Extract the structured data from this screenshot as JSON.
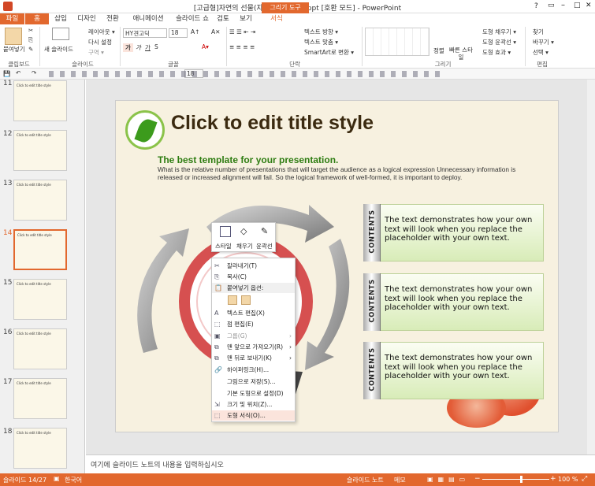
{
  "window": {
    "title": "[고급형]자연의 선물(자동완성형포함).ppt [호환 모드] - PowerPoint",
    "context_tab": "그리기 도구"
  },
  "tabs": [
    "파일",
    "홈",
    "삽입",
    "디자인",
    "전환",
    "애니메이션",
    "슬라이드 쇼",
    "검토",
    "보기",
    "서식"
  ],
  "ribbon": {
    "clipboard": {
      "paste": "붙여넣기",
      "label": "클립보드"
    },
    "slides": {
      "new_slide": "새 슬라이드",
      "layout": "레이아웃 ▾",
      "reset": "다시 설정",
      "section": "구역 ▾",
      "label": "슬라이드"
    },
    "font": {
      "name": "HY견고딕",
      "size": "18",
      "label": "글꼴"
    },
    "paragraph": {
      "text_direction": "텍스트 방향 ▾",
      "align_text": "텍스트 맞춤 ▾",
      "smartart": "SmartArt로 변환 ▾",
      "label": "단락"
    },
    "drawing": {
      "arrange": "정렬",
      "quick_styles": "빠른 스타일",
      "shape_fill": "도형 채우기 ▾",
      "shape_outline": "도형 윤곽선 ▾",
      "shape_effects": "도형 효과 ▾",
      "label": "그리기"
    },
    "editing": {
      "find": "찾기",
      "replace": "바꾸기 ▾",
      "select": "선택 ▾",
      "label": "편집"
    }
  },
  "qat": {
    "font_size": "18"
  },
  "thumbnails": [
    {
      "num": "11",
      "title": "Click to edit title style"
    },
    {
      "num": "12",
      "title": "Click to edit title style"
    },
    {
      "num": "13",
      "title": "Click to edit title style"
    },
    {
      "num": "14",
      "title": "Click to edit title style"
    },
    {
      "num": "15",
      "title": "Click to edit title style"
    },
    {
      "num": "16",
      "title": "Click to edit title style"
    },
    {
      "num": "17",
      "title": "Click to edit title style"
    },
    {
      "num": "18",
      "title": "Click to edit title style"
    }
  ],
  "slide": {
    "title": "Click to edit title style",
    "subtitle": "The best template for your presentation.",
    "body": "What is the relative number of presentations that will target the audience as a logical expression Unnecessary information is released or increased alignment will fail. So the logical framework of well-formed, it is important to deploy.",
    "boxes": [
      {
        "tag": "CONTENTS",
        "text": "The text demonstrates how your own text will look when you replace the placeholder with your own text."
      },
      {
        "tag": "CONTENTS",
        "text": "The text demonstrates how your own text will look when you replace the placeholder with your own text."
      },
      {
        "tag": "CONTENTS",
        "text": "The text demonstrates how your own text will look when you replace the placeholder with your own text."
      }
    ]
  },
  "mini_toolbar": {
    "style": "스타일",
    "fill": "채우기",
    "outline": "윤곽선"
  },
  "context_menu": [
    {
      "label": "잘라내기(T)",
      "icon": "✂",
      "state": "normal"
    },
    {
      "label": "복사(C)",
      "icon": "⎘",
      "state": "normal"
    },
    {
      "label": "붙여넣기 옵션:",
      "icon": "📋",
      "state": "header"
    },
    {
      "label": "",
      "icon": "",
      "state": "paste-icons"
    },
    {
      "label": "텍스트 편집(X)",
      "icon": "A",
      "state": "normal"
    },
    {
      "label": "점 편집(E)",
      "icon": "⬚",
      "state": "normal"
    },
    {
      "label": "그룹(G)",
      "icon": "▣",
      "state": "disabled"
    },
    {
      "label": "맨 앞으로 가져오기(R)",
      "icon": "⧉",
      "state": "submenu"
    },
    {
      "label": "맨 뒤로 보내기(K)",
      "icon": "⧉",
      "state": "submenu"
    },
    {
      "label": "하이퍼링크(H)...",
      "icon": "🔗",
      "state": "normal"
    },
    {
      "label": "그림으로 저장(S)...",
      "icon": "",
      "state": "normal"
    },
    {
      "label": "기본 도형으로 설정(D)",
      "icon": "",
      "state": "normal"
    },
    {
      "label": "크기 및 위치(Z)...",
      "icon": "⇲",
      "state": "normal"
    },
    {
      "label": "도형 서식(O)...",
      "icon": "⬚",
      "state": "highlight"
    }
  ],
  "notes": {
    "placeholder": "여기에 슬라이드 노트의 내용을 입력하십시오"
  },
  "status": {
    "slide": "슬라이드 14/27",
    "language": "한국어",
    "notes": "슬라이드 노트",
    "comments": "메모",
    "zoom": "100 %"
  },
  "colors": {
    "accent": "#e2682e",
    "title": "#3b2a10",
    "subtitle": "#2e7d12"
  }
}
